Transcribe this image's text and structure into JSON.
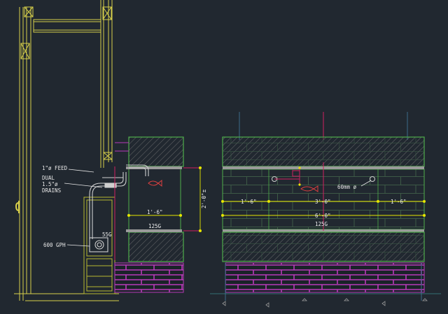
{
  "drawing": {
    "section_labels": {
      "feed": "1\"ø FEED",
      "drains_1": "DUAL",
      "drains_2": "1.5\"ø",
      "drains_3": "DRAINS",
      "pump": "600 GPH",
      "sump": "55G"
    },
    "section_dims": {
      "width": "1'-6\"",
      "tank": "125G",
      "height": "2'-0\"±"
    },
    "elevation_dims": {
      "left": "1'-6\"",
      "center": "3'-0\"",
      "right": "1'-6\"",
      "overall": "6'-0\"",
      "tank": "125G",
      "hole": "60mm ø"
    },
    "colors": {
      "background": "#212830",
      "wall": "#d8d04a",
      "cabinet": "#4fae4a",
      "brick": "#b83ab8",
      "dimension": "#e6e600",
      "glass": "#9a9a9a",
      "marker": "#d02060",
      "fish": "#e04040",
      "plumbing": "#cfcfcf"
    }
  }
}
